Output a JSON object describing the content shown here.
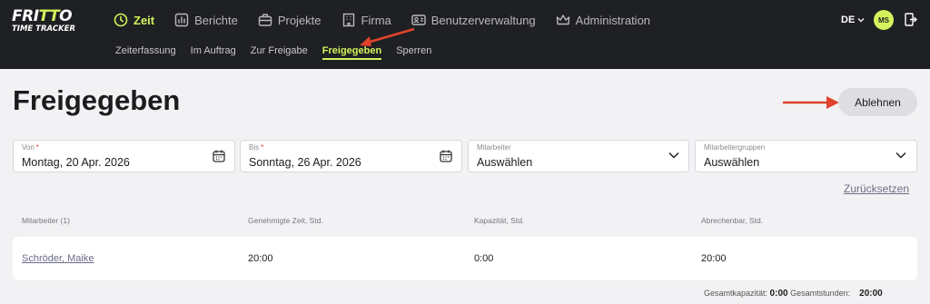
{
  "brand": {
    "line1_a": "FRI",
    "line1_b": "TT",
    "line1_c": "O",
    "line2": "TIME TRACKER"
  },
  "nav": [
    {
      "label": "Zeit",
      "icon": "clock-icon",
      "active": true
    },
    {
      "label": "Berichte",
      "icon": "chart-icon"
    },
    {
      "label": "Projekte",
      "icon": "briefcase-icon"
    },
    {
      "label": "Firma",
      "icon": "building-icon"
    },
    {
      "label": "Benutzerverwaltung",
      "icon": "id-card-icon"
    },
    {
      "label": "Administration",
      "icon": "crown-icon"
    }
  ],
  "subnav": [
    {
      "label": "Zeiterfassung"
    },
    {
      "label": "Im Auftrag"
    },
    {
      "label": "Zur Freigabe"
    },
    {
      "label": "Freigegeben",
      "active": true
    },
    {
      "label": "Sperren"
    }
  ],
  "header_right": {
    "language": "DE",
    "avatar_initials": "MS"
  },
  "page": {
    "title": "Freigegeben",
    "reject_button": "Ablehnen"
  },
  "filters": {
    "from": {
      "label": "Von",
      "required_mark": "*",
      "value": "Montag, 20 Apr. 2026"
    },
    "to": {
      "label": "Bis",
      "required_mark": "*",
      "value": "Sonntag, 26 Apr. 2026"
    },
    "employee": {
      "label": "Mitarbeiter",
      "value": "Auswählen"
    },
    "employee_groups": {
      "label": "Mitarbeitergruppen",
      "value": "Auswählen"
    },
    "reset": "Zurücksetzen"
  },
  "table": {
    "columns": [
      "Mitarbeiter (1)",
      "Genehmigte Zeit, Std.",
      "Kapazität, Std.",
      "Abrechenbar, Std."
    ],
    "rows": [
      {
        "employee": "Schröder, Maike",
        "approved": "20:00",
        "capacity": "0:00",
        "billable": "20:00"
      }
    ]
  },
  "footer": {
    "capacity_label": "Gesamtkapazität:",
    "capacity_value": "0:00",
    "hours_label": "Gesamtstunden:",
    "hours_value": "20:00"
  },
  "colors": {
    "accent": "#d4f25c",
    "topbar": "#1f2023",
    "annotation_arrow": "#e0432c"
  }
}
